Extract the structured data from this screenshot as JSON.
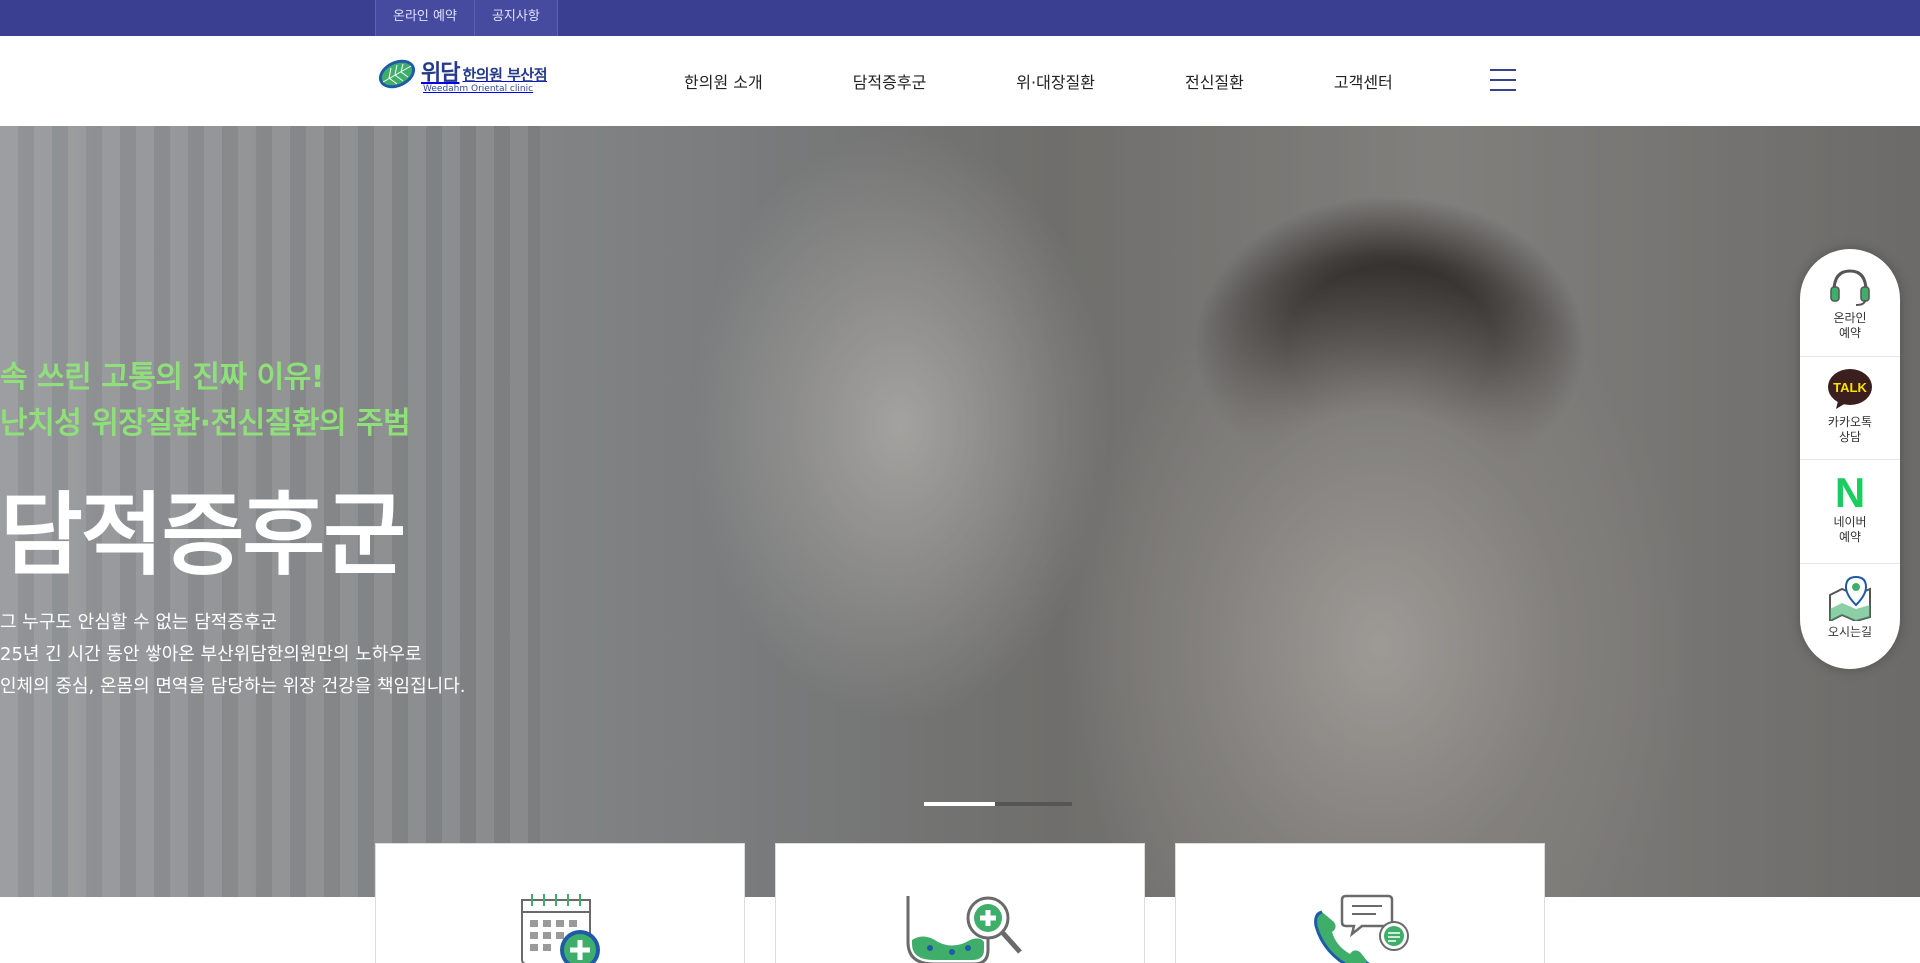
{
  "utility_bar": {
    "links": [
      "온라인 예약",
      "공지사항"
    ],
    "bg_color": "#3a3f92"
  },
  "header": {
    "logo": {
      "ko_main": "위담",
      "ko_sub": "한의원 부산점",
      "en": "Weedahm Oriental clinic"
    },
    "nav": [
      "한의원 소개",
      "담적증후군",
      "위·대장질환",
      "전신질환",
      "고객센터"
    ],
    "menu_icon": "hamburger-icon"
  },
  "hero": {
    "subtitle_line1": "속 쓰린 고통의 진짜 이유!",
    "subtitle_line2": "난치성 위장질환·전신질환의 주범",
    "headline": "담적증후군",
    "desc_line1": "그 누구도 안심할 수 없는 담적증후군",
    "desc_line2": "25년 긴 시간 동안 쌓아온 부산위담한의원만의 노하우로",
    "desc_line3": "인체의 중심, 온몸의 면역을 담당하는 위장 건강을 책임집니다.",
    "accent_color": "#8fe07a",
    "slider": {
      "current": 1,
      "total": 2
    }
  },
  "quick_cards": [
    {
      "icon": "calendar-plus-icon"
    },
    {
      "icon": "stomach-search-icon"
    },
    {
      "icon": "phone-chat-icon"
    }
  ],
  "quick_menu": {
    "items": [
      {
        "icon": "headset-icon",
        "label1": "온라인",
        "label2": "예약"
      },
      {
        "icon": "kakaotalk-icon",
        "badge": "TALK",
        "label1": "카카오톡",
        "label2": "상담"
      },
      {
        "icon": "naver-icon",
        "badge": "N",
        "label1": "네이버",
        "label2": "예약"
      },
      {
        "icon": "map-pin-icon",
        "label1": "오시는길",
        "label2": ""
      }
    ]
  }
}
